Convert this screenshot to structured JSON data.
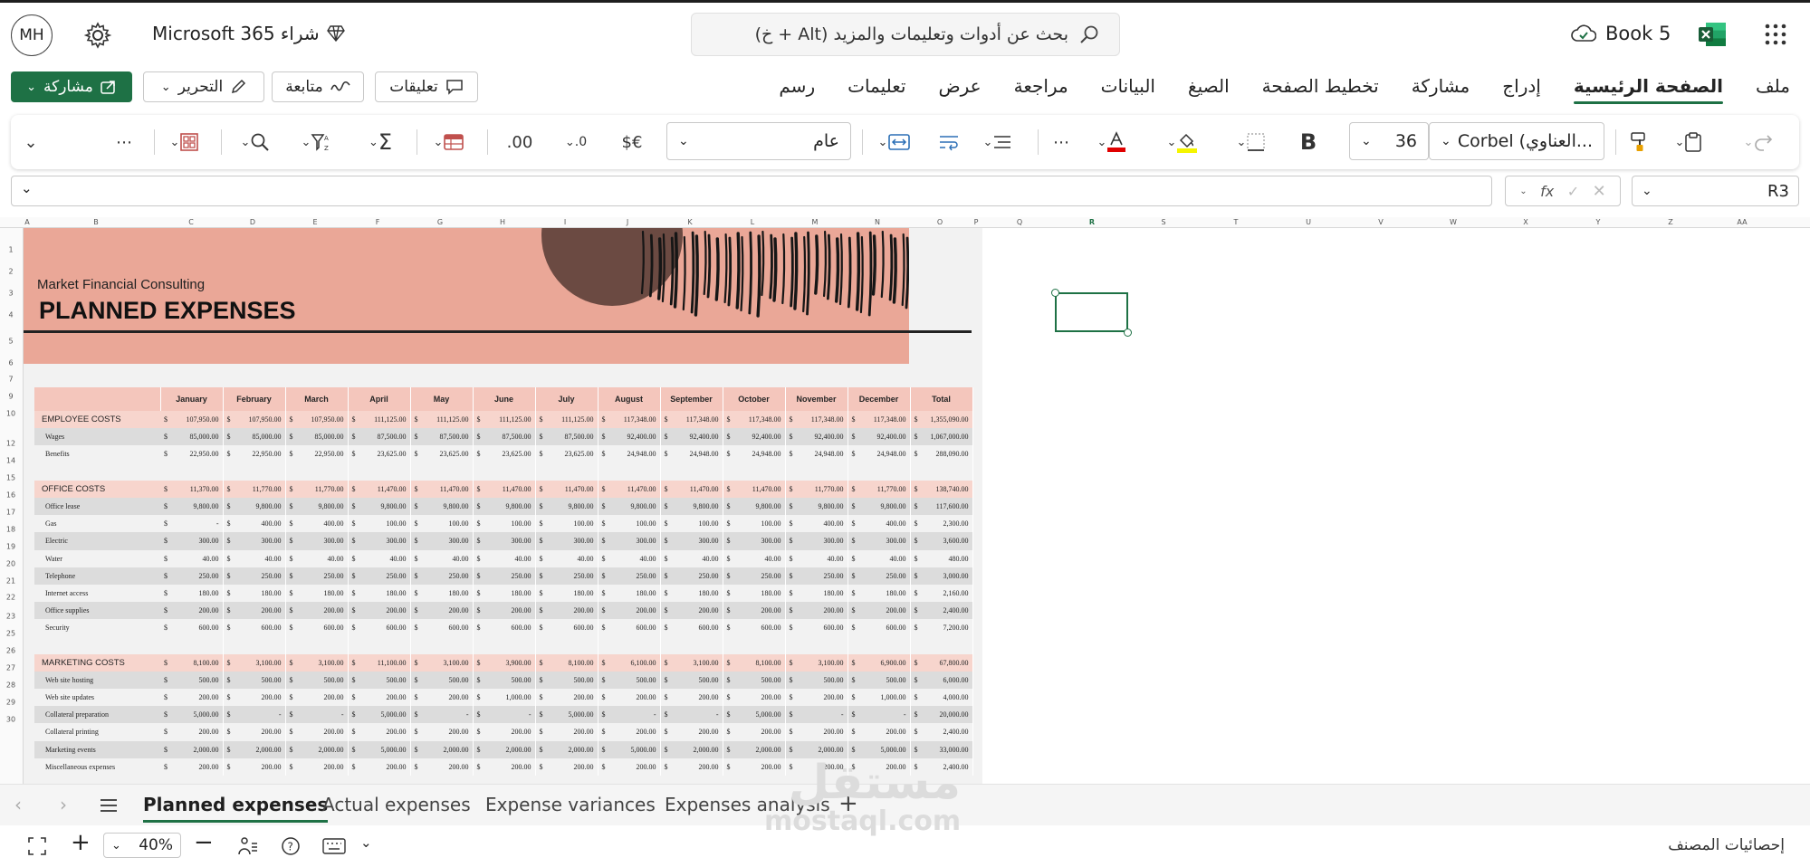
{
  "titlebar": {
    "avatar": "MH",
    "buy365": "شراء Microsoft 365",
    "search_placeholder": "بحث عن أدوات وتعليمات والمزيد (Alt + خ)",
    "doc_name": "Book 5"
  },
  "ribbon": {
    "tabs": [
      "ملف",
      "الصفحة الرئيسية",
      "إدراج",
      "مشاركة",
      "تخطيط الصفحة",
      "الصيغ",
      "البيانات",
      "مراجعة",
      "عرض",
      "تعليمات",
      "رسم"
    ],
    "active_tab": "الصفحة الرئيسية",
    "share_label": "مشاركة",
    "edit_label": "التحرير",
    "catchup_label": "متابعة",
    "comments_label": "تعليقات"
  },
  "toolbar": {
    "font_name": "Corbel (العناوي...",
    "font_size": "36",
    "number_format": "عام",
    "bold_label": "B",
    "currency_label": "$€",
    "more_label": "⋯"
  },
  "formula_bar": {
    "name_box": "R3",
    "fx": "fx",
    "value": ""
  },
  "grid": {
    "col_letters": [
      "A",
      "B",
      "C",
      "D",
      "E",
      "F",
      "G",
      "H",
      "I",
      "J",
      "K",
      "L",
      "M",
      "N",
      "O",
      "P",
      "Q",
      "R",
      "S",
      "T",
      "U",
      "V",
      "W",
      "X",
      "Y",
      "Z",
      "AA"
    ],
    "row_numbers": [
      "1",
      "2",
      "3",
      "4",
      "5",
      "6",
      "7",
      "9",
      "10",
      "12",
      "14",
      "15",
      "16",
      "17",
      "18",
      "19",
      "20",
      "21",
      "22",
      "23",
      "25",
      "26",
      "27",
      "28",
      "29",
      "30"
    ]
  },
  "sheet": {
    "company": "Market Financial Consulting",
    "title": "PLANNED EXPENSES",
    "months": [
      "January",
      "February",
      "March",
      "April",
      "May",
      "June",
      "July",
      "August",
      "September",
      "October",
      "November",
      "December",
      "Total"
    ],
    "currency": "$",
    "rows": [
      {
        "label": "EMPLOYEE COSTS",
        "kind": "cat",
        "values": [
          "107,950.00",
          "107,950.00",
          "107,950.00",
          "111,125.00",
          "111,125.00",
          "111,125.00",
          "111,125.00",
          "117,348.00",
          "117,348.00",
          "117,348.00",
          "117,348.00",
          "117,348.00",
          "1,355,090.00"
        ]
      },
      {
        "label": "Wages",
        "kind": "even",
        "values": [
          "85,000.00",
          "85,000.00",
          "85,000.00",
          "87,500.00",
          "87,500.00",
          "87,500.00",
          "87,500.00",
          "92,400.00",
          "92,400.00",
          "92,400.00",
          "92,400.00",
          "92,400.00",
          "1,067,000.00"
        ]
      },
      {
        "label": "Benefits",
        "kind": "odd",
        "values": [
          "22,950.00",
          "22,950.00",
          "22,950.00",
          "23,625.00",
          "23,625.00",
          "23,625.00",
          "23,625.00",
          "24,948.00",
          "24,948.00",
          "24,948.00",
          "24,948.00",
          "24,948.00",
          "288,090.00"
        ]
      },
      {
        "label": "",
        "kind": "blank",
        "values": []
      },
      {
        "label": "OFFICE COSTS",
        "kind": "cat",
        "values": [
          "11,370.00",
          "11,770.00",
          "11,770.00",
          "11,470.00",
          "11,470.00",
          "11,470.00",
          "11,470.00",
          "11,470.00",
          "11,470.00",
          "11,470.00",
          "11,770.00",
          "11,770.00",
          "138,740.00"
        ]
      },
      {
        "label": "Office lease",
        "kind": "even",
        "values": [
          "9,800.00",
          "9,800.00",
          "9,800.00",
          "9,800.00",
          "9,800.00",
          "9,800.00",
          "9,800.00",
          "9,800.00",
          "9,800.00",
          "9,800.00",
          "9,800.00",
          "9,800.00",
          "117,600.00"
        ]
      },
      {
        "label": "Gas",
        "kind": "odd",
        "values": [
          "-",
          "400.00",
          "400.00",
          "100.00",
          "100.00",
          "100.00",
          "100.00",
          "100.00",
          "100.00",
          "100.00",
          "400.00",
          "400.00",
          "2,300.00"
        ]
      },
      {
        "label": "Electric",
        "kind": "even",
        "values": [
          "300.00",
          "300.00",
          "300.00",
          "300.00",
          "300.00",
          "300.00",
          "300.00",
          "300.00",
          "300.00",
          "300.00",
          "300.00",
          "300.00",
          "3,600.00"
        ]
      },
      {
        "label": "Water",
        "kind": "odd",
        "values": [
          "40.00",
          "40.00",
          "40.00",
          "40.00",
          "40.00",
          "40.00",
          "40.00",
          "40.00",
          "40.00",
          "40.00",
          "40.00",
          "40.00",
          "480.00"
        ]
      },
      {
        "label": "Telephone",
        "kind": "even",
        "values": [
          "250.00",
          "250.00",
          "250.00",
          "250.00",
          "250.00",
          "250.00",
          "250.00",
          "250.00",
          "250.00",
          "250.00",
          "250.00",
          "250.00",
          "3,000.00"
        ]
      },
      {
        "label": "Internet access",
        "kind": "odd",
        "values": [
          "180.00",
          "180.00",
          "180.00",
          "180.00",
          "180.00",
          "180.00",
          "180.00",
          "180.00",
          "180.00",
          "180.00",
          "180.00",
          "180.00",
          "2,160.00"
        ]
      },
      {
        "label": "Office supplies",
        "kind": "even",
        "values": [
          "200.00",
          "200.00",
          "200.00",
          "200.00",
          "200.00",
          "200.00",
          "200.00",
          "200.00",
          "200.00",
          "200.00",
          "200.00",
          "200.00",
          "2,400.00"
        ]
      },
      {
        "label": "Security",
        "kind": "odd",
        "values": [
          "600.00",
          "600.00",
          "600.00",
          "600.00",
          "600.00",
          "600.00",
          "600.00",
          "600.00",
          "600.00",
          "600.00",
          "600.00",
          "600.00",
          "7,200.00"
        ]
      },
      {
        "label": "",
        "kind": "blank",
        "values": []
      },
      {
        "label": "MARKETING COSTS",
        "kind": "cat",
        "values": [
          "8,100.00",
          "3,100.00",
          "3,100.00",
          "11,100.00",
          "3,100.00",
          "3,900.00",
          "8,100.00",
          "6,100.00",
          "3,100.00",
          "8,100.00",
          "3,100.00",
          "6,900.00",
          "67,800.00"
        ]
      },
      {
        "label": "Web site hosting",
        "kind": "even",
        "values": [
          "500.00",
          "500.00",
          "500.00",
          "500.00",
          "500.00",
          "500.00",
          "500.00",
          "500.00",
          "500.00",
          "500.00",
          "500.00",
          "500.00",
          "6,000.00"
        ]
      },
      {
        "label": "Web site updates",
        "kind": "odd",
        "values": [
          "200.00",
          "200.00",
          "200.00",
          "200.00",
          "200.00",
          "1,000.00",
          "200.00",
          "200.00",
          "200.00",
          "200.00",
          "200.00",
          "1,000.00",
          "4,000.00"
        ]
      },
      {
        "label": "Collateral preparation",
        "kind": "even",
        "values": [
          "5,000.00",
          "-",
          "-",
          "5,000.00",
          "-",
          "-",
          "5,000.00",
          "-",
          "-",
          "5,000.00",
          "-",
          "-",
          "20,000.00"
        ]
      },
      {
        "label": "Collateral printing",
        "kind": "odd",
        "values": [
          "200.00",
          "200.00",
          "200.00",
          "200.00",
          "200.00",
          "200.00",
          "200.00",
          "200.00",
          "200.00",
          "200.00",
          "200.00",
          "200.00",
          "2,400.00"
        ]
      },
      {
        "label": "Marketing events",
        "kind": "even",
        "values": [
          "2,000.00",
          "2,000.00",
          "2,000.00",
          "5,000.00",
          "2,000.00",
          "2,000.00",
          "2,000.00",
          "5,000.00",
          "2,000.00",
          "2,000.00",
          "2,000.00",
          "5,000.00",
          "33,000.00"
        ]
      },
      {
        "label": "Miscellaneous expenses",
        "kind": "odd",
        "values": [
          "200.00",
          "200.00",
          "200.00",
          "200.00",
          "200.00",
          "200.00",
          "200.00",
          "200.00",
          "200.00",
          "200.00",
          "200.00",
          "200.00",
          "2,400.00"
        ]
      }
    ]
  },
  "sheet_tabs": [
    "Planned expenses",
    "Actual expenses",
    "Expense variances",
    "Expenses analysis"
  ],
  "active_sheet": "Planned expenses",
  "status": {
    "zoom": "40%",
    "workbook_stats": "إحصائيات المصنف"
  },
  "watermark": {
    "arabic": "مستقل",
    "latin": "mostaql.com"
  },
  "colors": {
    "accent": "#1e7145",
    "banner": "#eaa797",
    "header_fill": "#f4c6bc",
    "category_fill": "#f7d5cd",
    "circle": "#6b4a42"
  }
}
